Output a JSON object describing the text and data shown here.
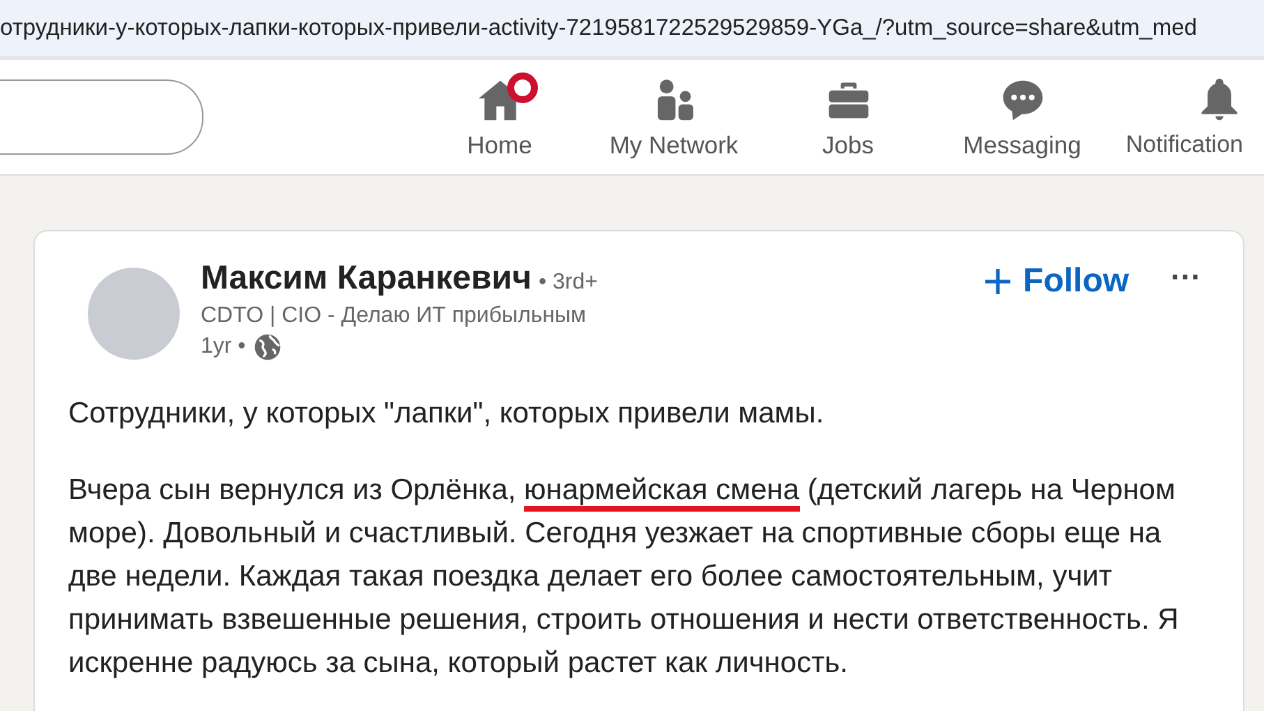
{
  "address_bar": {
    "url": "отрудники-у-которых-лапки-которых-привели-activity-7219581722529529859-YGa_/?utm_source=share&utm_med"
  },
  "nav": [
    {
      "kind": "home",
      "label": "Home",
      "badge": true
    },
    {
      "kind": "network",
      "label": "My Network",
      "badge": false
    },
    {
      "kind": "jobs",
      "label": "Jobs",
      "badge": false
    },
    {
      "kind": "messaging",
      "label": "Messaging",
      "badge": false
    },
    {
      "kind": "bell",
      "label": "Notification",
      "badge": false
    }
  ],
  "post": {
    "author": "Максим Каранкевич",
    "degree": "• 3rd+",
    "headline": "CDTO | CIO - Делаю ИТ прибыльным",
    "time": "1yr •",
    "follow": "Follow",
    "more": "···",
    "paragraphs": [
      [
        {
          "text": "Сотрудники, у которых \"лапки\", которых привели мамы.",
          "highlighted": false
        }
      ],
      [
        {
          "text": "Вчера сын вернулся из Орлёнка, ",
          "highlighted": false
        },
        {
          "text": "юнармейская смена",
          "highlighted": true
        },
        {
          "text": " (детский лагерь на Черном море). Довольный и счастливый. Сегодня уезжает на спортивные сборы еще на две недели. Каждая такая поездка делает его более самостоятельным, учит принимать взвешенные решения, строить отношения и нести ответственность. Я искренне радуюсь за сына, который растет как личность.",
          "highlighted": false
        }
      ]
    ]
  }
}
